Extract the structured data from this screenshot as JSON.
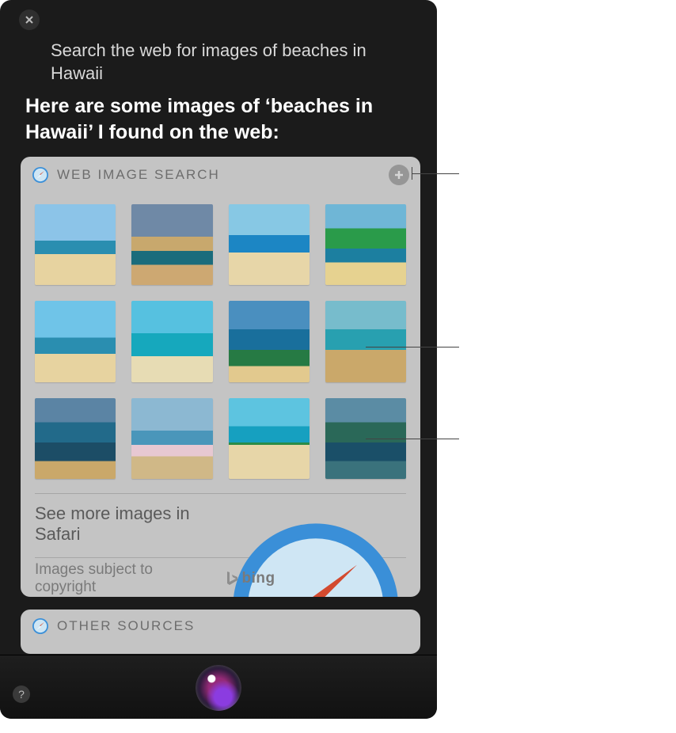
{
  "query": "Search the web for images of beaches in Hawaii",
  "response": "Here are some images of ‘beaches in Hawaii’ I found on the web:",
  "card": {
    "title": "WEB IMAGE SEARCH",
    "see_more": "See more images in Safari",
    "copyright": "Images subject to copyright",
    "provider": "bing",
    "images": [
      {
        "name": "beach-thumb-1"
      },
      {
        "name": "beach-thumb-2"
      },
      {
        "name": "beach-thumb-3"
      },
      {
        "name": "beach-thumb-4"
      },
      {
        "name": "beach-thumb-5"
      },
      {
        "name": "beach-thumb-6"
      },
      {
        "name": "beach-thumb-7"
      },
      {
        "name": "beach-thumb-8"
      },
      {
        "name": "beach-thumb-9"
      },
      {
        "name": "beach-thumb-10"
      },
      {
        "name": "beach-thumb-11"
      },
      {
        "name": "beach-thumb-12"
      }
    ]
  },
  "other": {
    "title": "OTHER SOURCES"
  },
  "help_glyph": "?"
}
